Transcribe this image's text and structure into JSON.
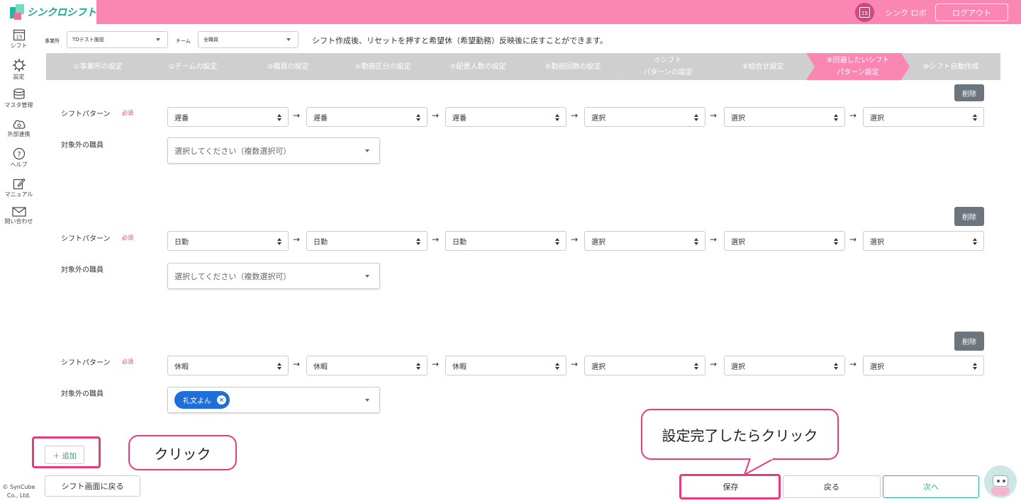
{
  "app": {
    "title": "シンクロシフト",
    "user_name": "シンク ロボ",
    "logout_label": "ログアウト",
    "calendar_day": "15",
    "copyright": "© SynCube Co., Ltd."
  },
  "sidebar": {
    "items": [
      {
        "label": "シフト",
        "icon": "calendar-icon"
      },
      {
        "label": "設定",
        "icon": "gear-icon"
      },
      {
        "label": "マスタ管理",
        "icon": "database-icon"
      },
      {
        "label": "外部連携",
        "icon": "cloud-sync-icon"
      },
      {
        "label": "ヘルプ",
        "icon": "help-icon"
      },
      {
        "label": "マニュアル",
        "icon": "edit-icon"
      },
      {
        "label": "問い合わせ",
        "icon": "mail-icon"
      }
    ]
  },
  "filters": {
    "office_label": "事業所",
    "office_value": "TDテスト施設",
    "team_label": "チーム",
    "team_value": "全職員"
  },
  "notice": "シフト作成後、リセットを押すと希望休（希望勤務）反映後に戻すことができます。",
  "steps": [
    {
      "label": "①事業所の設定"
    },
    {
      "label": "②チームの設定"
    },
    {
      "label": "③職員の設定"
    },
    {
      "label": "④勤務区分の設定"
    },
    {
      "label": "⑤配置人数の設定"
    },
    {
      "label": "⑥勤務回数の設定"
    },
    {
      "label": "⑦シフト\nパターンの設定"
    },
    {
      "label": "⑧組合せ設定"
    },
    {
      "label": "⑨回避したいシフト\nパターン設定"
    },
    {
      "label": "⑩シフト自動作成"
    }
  ],
  "active_step": 8,
  "form": {
    "pattern_label": "シフトパターン",
    "required_label": "必須",
    "excluded_label": "対象外の職員",
    "placeholder": "選択してください（複数選択可）",
    "delete_label": "削除",
    "arrow": "→"
  },
  "blocks": [
    {
      "patterns": [
        "遅番",
        "遅番",
        "遅番",
        "選択",
        "選択",
        "選択"
      ],
      "excluded": []
    },
    {
      "patterns": [
        "日勤",
        "日勤",
        "日勤",
        "選択",
        "選択",
        "選択"
      ],
      "excluded": []
    },
    {
      "patterns": [
        "休暇",
        "休暇",
        "休暇",
        "選択",
        "選択",
        "選択"
      ],
      "excluded": [
        "礼文よん"
      ]
    }
  ],
  "buttons": {
    "add": "＋ 追加",
    "back_to_shift": "シフト画面に戻る",
    "save": "保存",
    "return": "戻る",
    "next": "次へ"
  },
  "annotations": {
    "click": "クリック",
    "save_click": "設定完了したらクリック"
  },
  "colors": {
    "header_pink": "#fb86b2",
    "active_step": "#fb86b2",
    "step_inactive": "#cfcfcf",
    "accent_teal": "#2bb3a3",
    "highlight": "#e43d7b",
    "chip_blue": "#1e6fd9",
    "delete_gray": "#6c757d"
  }
}
